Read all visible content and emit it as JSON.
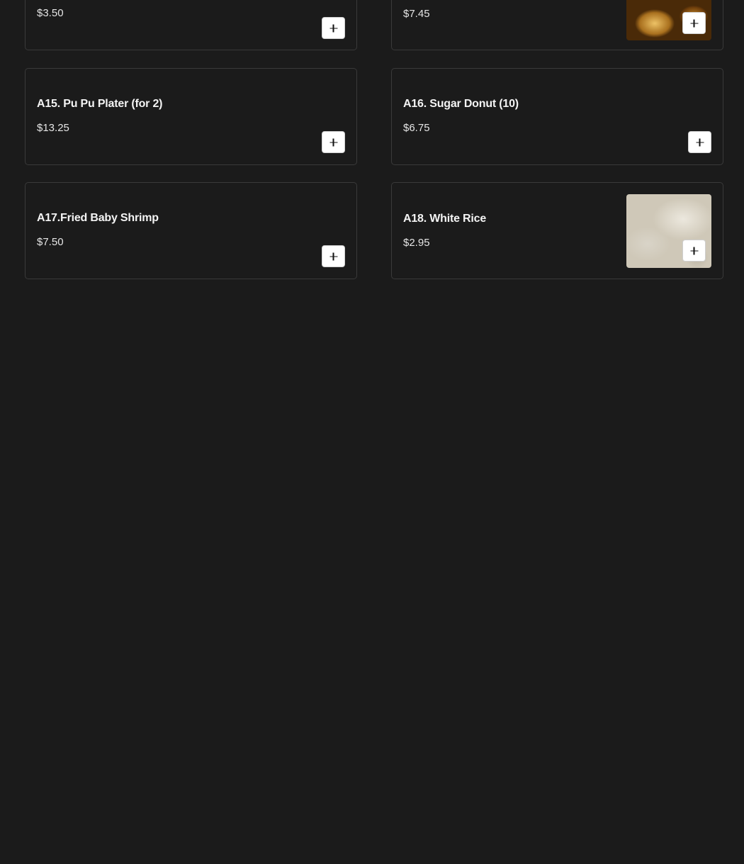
{
  "menu": {
    "items": [
      {
        "name": "",
        "price": "$3.50",
        "has_image": false,
        "add_label": "Add item"
      },
      {
        "name": "",
        "price": "$7.45",
        "has_image": true,
        "image": "fried-food-photo",
        "add_label": "Add item"
      },
      {
        "name": "A15. Pu Pu Plater (for 2)",
        "price": "$13.25",
        "has_image": false,
        "add_label": "Add item"
      },
      {
        "name": "A16. Sugar Donut (10)",
        "price": "$6.75",
        "has_image": false,
        "add_label": "Add item"
      },
      {
        "name": "A17.Fried Baby Shrimp",
        "price": "$7.50",
        "has_image": false,
        "add_label": "Add item"
      },
      {
        "name": "A18. White Rice",
        "price": "$2.95",
        "has_image": true,
        "image": "white-rice-photo",
        "add_label": "Add item"
      }
    ]
  },
  "icons": {
    "add": "plus-icon"
  },
  "colors": {
    "background": "#1b1b1b",
    "card_border": "#3a3a3a",
    "button_bg": "#ffffff",
    "text": "#f4f4f4"
  }
}
